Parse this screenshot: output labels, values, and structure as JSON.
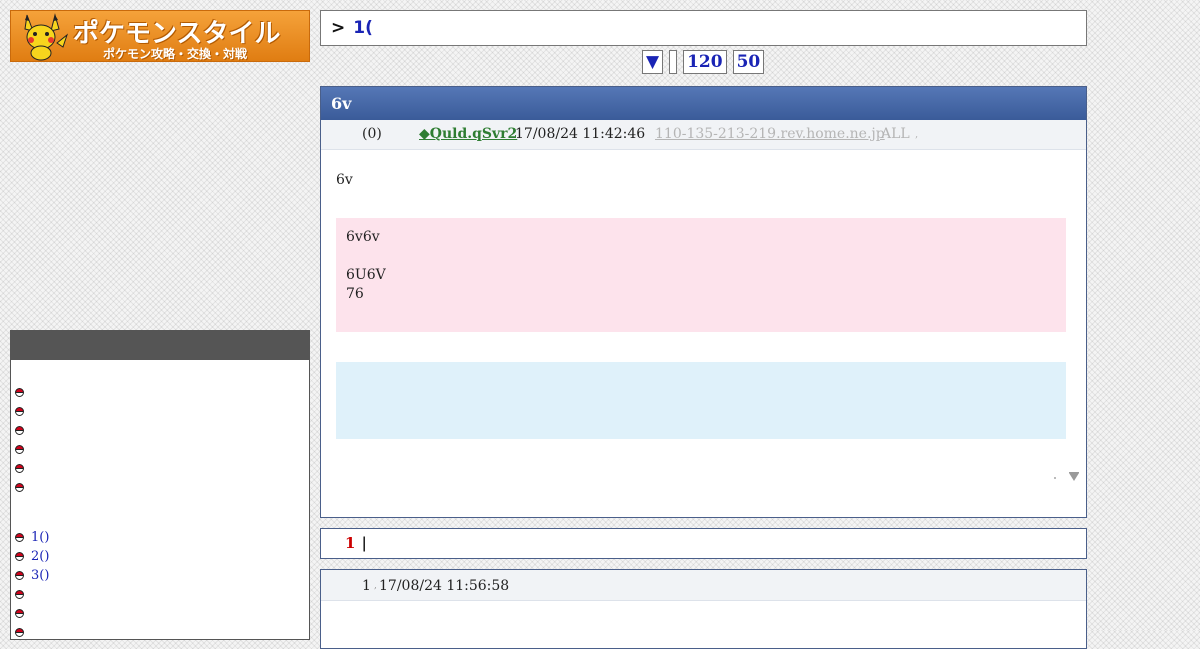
{
  "logo": {
    "title": "ポケモンスタイル",
    "subtitle": "ポケモン攻略・交換・対戦"
  },
  "search": {
    "prefix": ">",
    "query": "1("
  },
  "pager": {
    "down": "▼",
    "blank": "",
    "n120": "120",
    "n50": "50"
  },
  "thread": {
    "title": "6v",
    "count": "(0)",
    "trip": "◆Quld.qSvr2",
    "date": "17/08/24 11:42:46",
    "host": "110-135-213-219.rev.home.ne.jp",
    "all": "ALL",
    "dot": ",",
    "body": "6v",
    "pink_lines": [
      "6v6v",
      "",
      "6U6V",
      "76"
    ]
  },
  "sidebar": {
    "items": [
      "",
      "",
      "",
      "",
      "",
      ""
    ],
    "links": [
      "1()",
      "2()",
      "3()",
      "",
      "",
      ""
    ]
  },
  "jump": {
    "num": "1",
    "sep": "|"
  },
  "reply": {
    "num": "1",
    "sep": ",",
    "date": "17/08/24 11:56:58"
  },
  "colors": {
    "header_blue": "#3a5b99",
    "pink": "#fde3ec",
    "light_blue": "#dff1fa",
    "logo_orange": "#e07d12"
  }
}
